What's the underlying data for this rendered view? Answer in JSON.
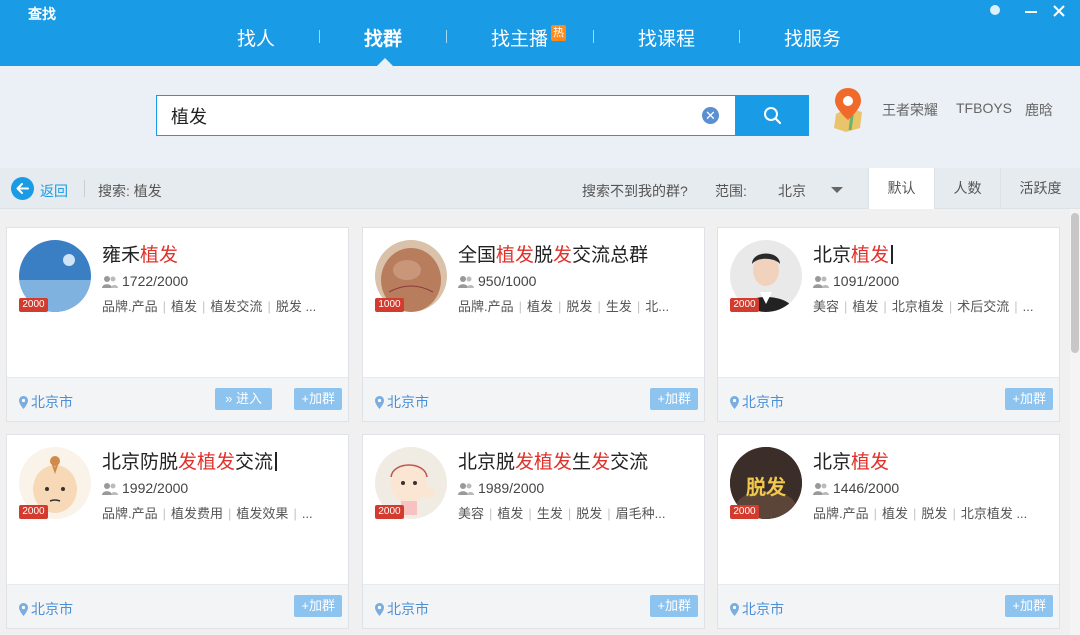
{
  "window": {
    "title": "查找"
  },
  "nav": {
    "items": [
      {
        "label": "找人",
        "active": false
      },
      {
        "label": "找群",
        "active": true
      },
      {
        "label": "找主播",
        "badge": "热",
        "active": false
      },
      {
        "label": "找课程",
        "active": false
      },
      {
        "label": "找服务",
        "active": false
      }
    ]
  },
  "search": {
    "value": "植发",
    "hot_words": [
      "王者荣耀",
      "TFBOYS",
      "鹿晗"
    ]
  },
  "filter": {
    "back_label": "返回",
    "summary": "搜索: 植发",
    "not_found": "搜索不到我的群?",
    "range_label": "范围:",
    "range_value": "北京",
    "sort_tabs": [
      {
        "label": "默认",
        "active": true
      },
      {
        "label": "人数",
        "active": false
      },
      {
        "label": "活跃度",
        "active": false
      }
    ]
  },
  "results": [
    {
      "name_parts": [
        "雍禾",
        "植发"
      ],
      "count": "1722/2000",
      "badge": "2000",
      "tags": [
        "品牌.产品",
        "植发",
        "植发交流",
        "脱发 ..."
      ],
      "location": "北京市",
      "enter_label": "» 进入",
      "join_label": "+加群",
      "avatar_bg": "#3a7fc4"
    },
    {
      "name_parts": [
        "全国",
        "植发",
        "脱",
        "发",
        "交流总群"
      ],
      "count": "950/1000",
      "badge": "1000",
      "tags": [
        "品牌.产品",
        "植发",
        "脱发",
        "生发",
        "北..."
      ],
      "location": "北京市",
      "join_label": "+加群",
      "avatar_bg": "#b87d5d"
    },
    {
      "name_parts": [
        "北京",
        "植发"
      ],
      "cursor": true,
      "count": "1091/2000",
      "badge": "2000",
      "tags": [
        "美容",
        "植发",
        "北京植发",
        "术后交流",
        "..."
      ],
      "location": "北京市",
      "join_label": "+加群",
      "avatar_bg": "#2a2a2a"
    },
    {
      "name_parts": [
        "北京防脱",
        "发",
        "植发",
        "交流"
      ],
      "cursor": true,
      "count": "1992/2000",
      "badge": "2000",
      "tags": [
        "品牌.产品",
        "植发费用",
        "植发效果",
        "..."
      ],
      "location": "北京市",
      "join_label": "+加群",
      "avatar_bg": "#f3e6d8"
    },
    {
      "name_parts": [
        "北京脱",
        "发",
        "植发",
        "生",
        "发",
        "交流"
      ],
      "count": "1989/2000",
      "badge": "2000",
      "tags": [
        "美容",
        "植发",
        "生发",
        "脱发",
        "眉毛种..."
      ],
      "location": "北京市",
      "join_label": "+加群",
      "avatar_bg": "#f0ebe3"
    },
    {
      "name_parts": [
        "北京",
        "植发"
      ],
      "count": "1446/2000",
      "badge": "2000",
      "avatar_text": "脱发",
      "tags": [
        "品牌.产品",
        "植发",
        "脱发",
        "北京植发 ..."
      ],
      "location": "北京市",
      "join_label": "+加群",
      "avatar_bg": "#3b2e28"
    }
  ],
  "colors": {
    "primary": "#1a9be6",
    "highlight": "#e0322b",
    "badge": "#d33b2e"
  }
}
